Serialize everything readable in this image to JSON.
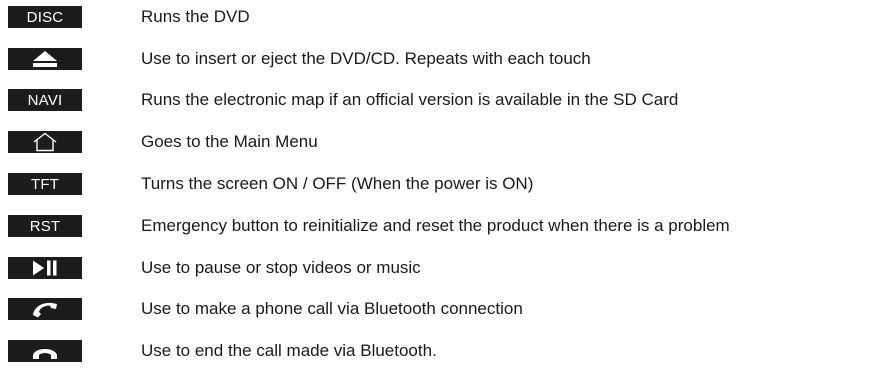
{
  "buttons": [
    {
      "key_label": "DISC",
      "icon": "",
      "description": "Runs the DVD"
    },
    {
      "key_label": "",
      "icon": "eject-icon",
      "description": "Use to insert or eject the DVD/CD. Repeats with each touch"
    },
    {
      "key_label": "NAVI",
      "icon": "",
      "description": "Runs the electronic map if an official version is available in the SD Card"
    },
    {
      "key_label": "",
      "icon": "home-icon",
      "description": "Goes to the Main Menu"
    },
    {
      "key_label": "TFT",
      "icon": "",
      "description": "Turns the screen ON / OFF (When the power is ON)"
    },
    {
      "key_label": "RST",
      "icon": "",
      "description": "Emergency button to reinitialize and reset the product when there is a problem"
    },
    {
      "key_label": "",
      "icon": "play-pause-icon",
      "description": "Use to pause or stop videos or music"
    },
    {
      "key_label": "",
      "icon": "phone-call-icon",
      "description": "Use to make a phone call via Bluetooth connection"
    },
    {
      "key_label": "",
      "icon": "phone-hangup-icon",
      "description": "Use to end the call made via Bluetooth."
    }
  ]
}
